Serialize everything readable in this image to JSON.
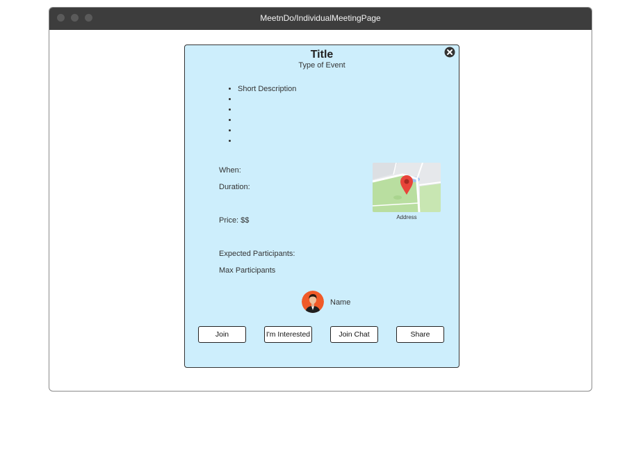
{
  "window": {
    "title": "MeetnDo/IndividualMeetingPage"
  },
  "event": {
    "title": "Title",
    "type": "Type of Event",
    "description_items": [
      "Short Description",
      "",
      "",
      "",
      "",
      ""
    ],
    "when_label": "When:",
    "duration_label": "Duration:",
    "price_label": "Price: $$",
    "expected_label": "Expected Participants:",
    "max_label": "Max Participants",
    "address": "Address"
  },
  "host": {
    "name": "Name"
  },
  "actions": {
    "join": "Join",
    "interested": "I'm Interested",
    "join_chat": "Join Chat",
    "share": "Share"
  },
  "icons": {
    "close": "close-circle-icon",
    "map_pin": "map-pin-icon"
  },
  "colors": {
    "card_bg": "#cdeefc",
    "titlebar_bg": "#3d3d3d",
    "pin": "#e8443a"
  }
}
